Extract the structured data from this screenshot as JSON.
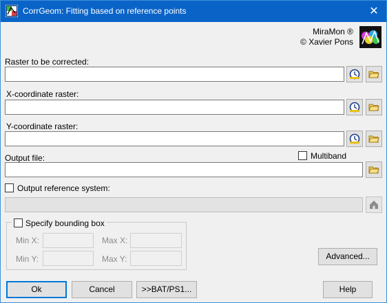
{
  "window": {
    "title": "CorrGeom: Fitting based on reference points",
    "close_symbol": "✕"
  },
  "brand": {
    "name": "MiraMon ®",
    "author": "© Xavier Pons"
  },
  "fields": {
    "raster_label": "Raster to be corrected:",
    "x_label": "X-coordinate raster:",
    "y_label": "Y-coordinate raster:",
    "output_label": "Output file:",
    "multiband_label": "Multiband",
    "output_ref_label": "Output reference system:"
  },
  "bbox": {
    "legend": "Specify bounding box",
    "min_x": "Min X:",
    "max_x": "Max X:",
    "min_y": "Min Y:",
    "max_y": "Max Y:"
  },
  "buttons": {
    "advanced": "Advanced...",
    "ok": "Ok",
    "cancel": "Cancel",
    "bat": ">>BAT/PS1...",
    "help": "Help"
  },
  "icons": {
    "app": "app-icon",
    "clock": "clock-icon",
    "folder": "folder-icon",
    "home": "home-icon"
  },
  "colors": {
    "titlebar": "#0a64c8",
    "default_button_border": "#0078d7"
  }
}
